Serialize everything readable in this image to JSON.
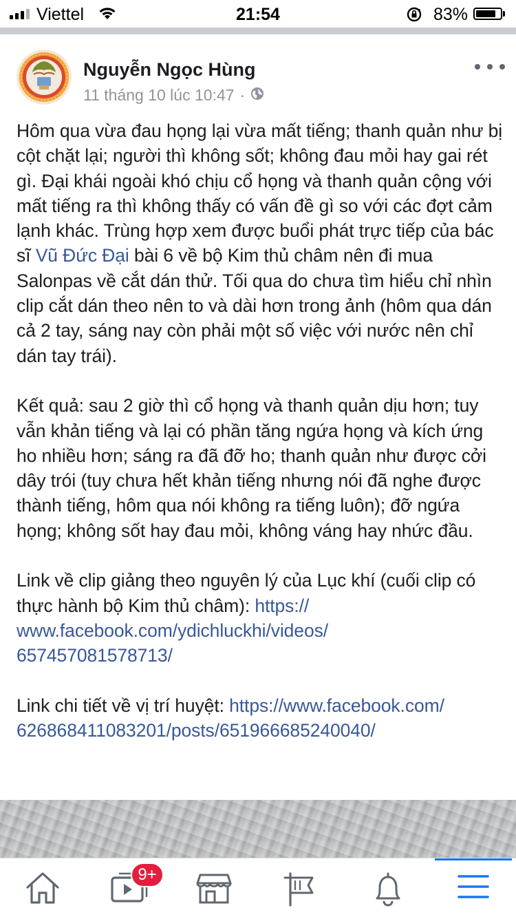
{
  "status_bar": {
    "carrier": "Viettel",
    "time": "21:54",
    "battery_percent": "83%",
    "battery_level": 0.83
  },
  "post": {
    "author": "Nguyễn Ngọc Hùng",
    "timestamp": "11 tháng 10 lúc 10:47",
    "separator": "·",
    "privacy_icon": "globe-icon",
    "para1_before_link": "Hôm qua vừa đau họng lại vừa mất tiếng; thanh quản như bị cột chặt lại; người thì không sốt; không đau mỏi hay gai rét gì. Đại khái ngoài khó chịu cổ họng và thanh quản cộng với mất tiếng ra thì không thấy có vấn đề gì so với các đợt cảm lạnh khác. Trùng hợp xem được buổi phát trực tiếp của bác sĩ ",
    "para1_mention": "Vũ Đức Đại",
    "para1_after_link": " bài 6 về bộ Kim thủ châm nên đi mua Salonpas về cắt dán thử. Tối qua do chưa tìm hiểu chỉ nhìn clip cắt dán theo nên to và dài hơn trong ảnh (hôm qua dán cả 2 tay, sáng nay còn phải một số việc với nước nên chỉ dán tay trái).",
    "para2": "Kết quả: sau 2 giờ thì cổ họng và thanh quản dịu hơn; tuy vẫn khản tiếng và lại có phần tăng ngứa họng và kích ứng ho nhiều hơn; sáng ra đã đỡ ho; thanh quản như được cởi dây trói (tuy chưa hết khản tiếng nhưng nói đã nghe được thành tiếng, hôm qua nói không ra tiếng luôn); đỡ ngứa họng; không sốt hay đau mỏi, không váng hay nhức đầu.",
    "para3_text": "Link về clip giảng theo nguyên lý của Lục khí (cuối clip có thực hành bộ Kim thủ châm): ",
    "para3_link": "https://www.facebook.com/ydichluckhi/videos/657457081578713/",
    "para4_text": "Link chi tiết về vị trí huyệt: ",
    "para4_link": "https://www.facebook.com/626868411083201/posts/651966685240040/"
  },
  "bottom_nav": {
    "items": [
      "home-icon",
      "video-icon",
      "marketplace-icon",
      "pages-flag-icon",
      "notifications-bell-icon",
      "menu-icon"
    ],
    "video_badge": "9+",
    "active": "menu-icon"
  },
  "colors": {
    "link": "#385898",
    "badge": "#e41e3f",
    "active": "#1877f2",
    "meta": "#90949c"
  }
}
